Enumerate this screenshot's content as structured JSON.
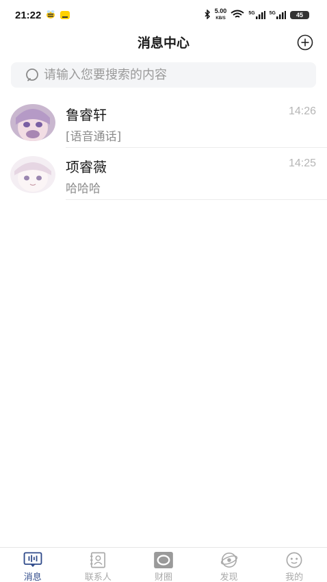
{
  "status_bar": {
    "time": "21:22",
    "network_speed_value": "5.00",
    "network_speed_unit": "KB/S",
    "signal_1": "5G",
    "signal_2": "5G",
    "battery": "45"
  },
  "header": {
    "title": "消息中心"
  },
  "search": {
    "placeholder": "请输入您要搜索的内容"
  },
  "conversations": [
    {
      "name": "鲁睿轩",
      "time": "14:26",
      "preview": "[语音通话]"
    },
    {
      "name": "项睿薇",
      "time": "14:25",
      "preview": "哈哈哈"
    }
  ],
  "tabs": [
    {
      "label": "消息",
      "icon": "message-icon",
      "active": true
    },
    {
      "label": "联系人",
      "icon": "contacts-icon",
      "active": false
    },
    {
      "label": "财圈",
      "icon": "moments-icon",
      "active": false
    },
    {
      "label": "发现",
      "icon": "discover-icon",
      "active": false
    },
    {
      "label": "我的",
      "icon": "profile-icon",
      "active": false
    }
  ],
  "colors": {
    "accent": "#2f4a8a",
    "inactive": "#a9a9a9",
    "search_bg": "#f4f5f7"
  }
}
